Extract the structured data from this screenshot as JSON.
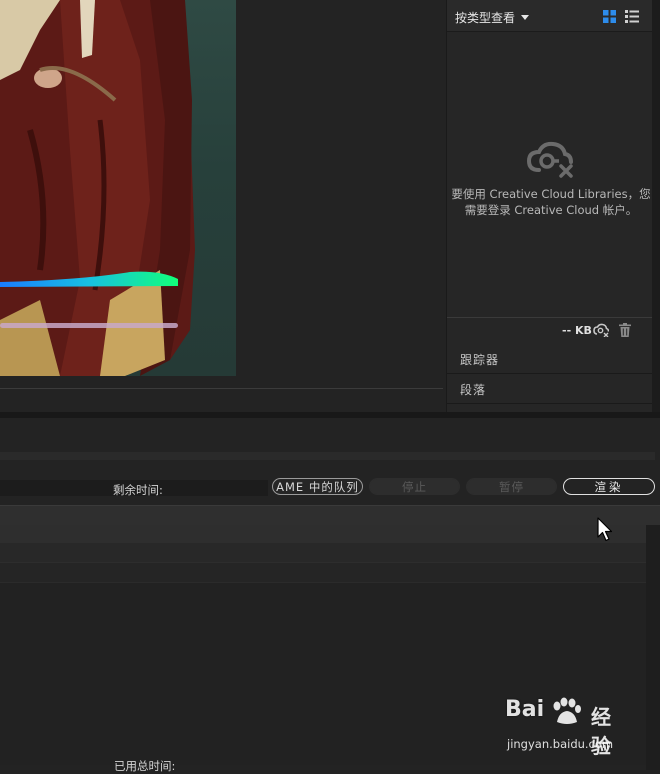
{
  "libraries": {
    "view_dropdown": "按类型查看",
    "message_line1": "要使用 Creative Cloud Libraries，您",
    "message_line2": "需要登录 Creative Cloud 帐户。",
    "storage": "-- KB"
  },
  "panels": {
    "tracker": "跟踪器",
    "paragraph": "段落"
  },
  "render_queue": {
    "remaining_time_label": "剩余时间:",
    "elapsed_time_label": "已用总时间:",
    "ame_queue_button": "AME 中的队列",
    "stop_button": "停止",
    "pause_button": "暂停",
    "render_button": "渲染"
  },
  "watermark": {
    "brand": "Bai",
    "brand_suffix": "经验",
    "url": "jingyan.baidu.com"
  },
  "colors": {
    "accent_blue": "#2d8ceb",
    "panel_bg": "#262626",
    "app_bg": "#232323"
  }
}
